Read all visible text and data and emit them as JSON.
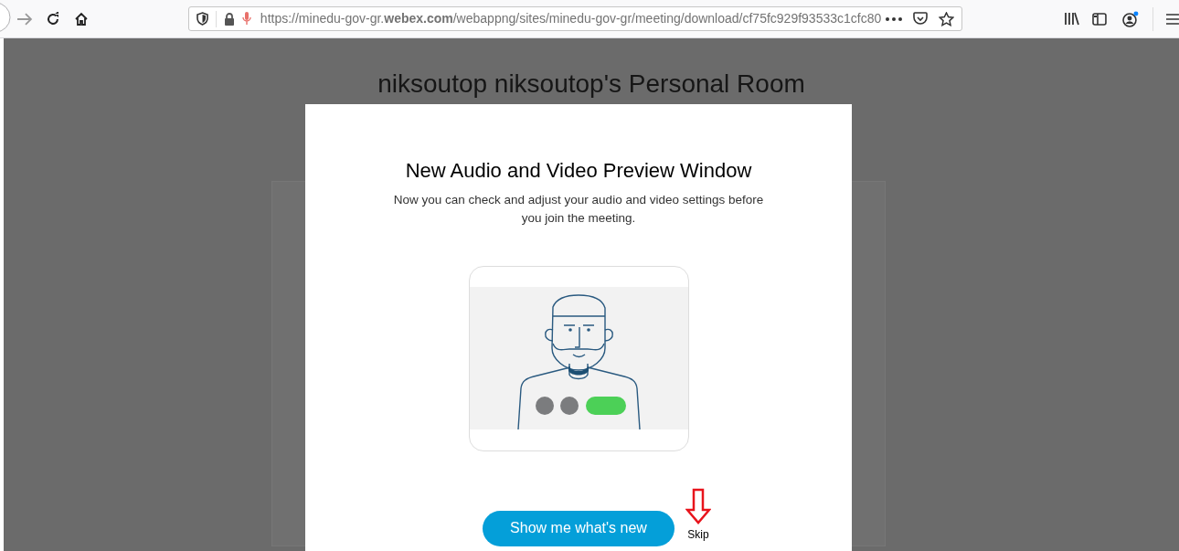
{
  "browser": {
    "url": "https://minedu-gov-gr.**webex.com**/webappng/sites/minedu-gov-gr/meeting/download/cf75fc929f93533c1cfc80"
  },
  "page": {
    "room_title": "niksoutop niksoutop's Personal Room"
  },
  "dialog": {
    "title": "New Audio and Video Preview Window",
    "description": "Now you can check and adjust your audio and video settings before you join the meeting.",
    "buttons": [
      {
        "label": "Show me what's new",
        "kind": "primary"
      },
      {
        "label": "Skip",
        "kind": "link"
      }
    ]
  }
}
